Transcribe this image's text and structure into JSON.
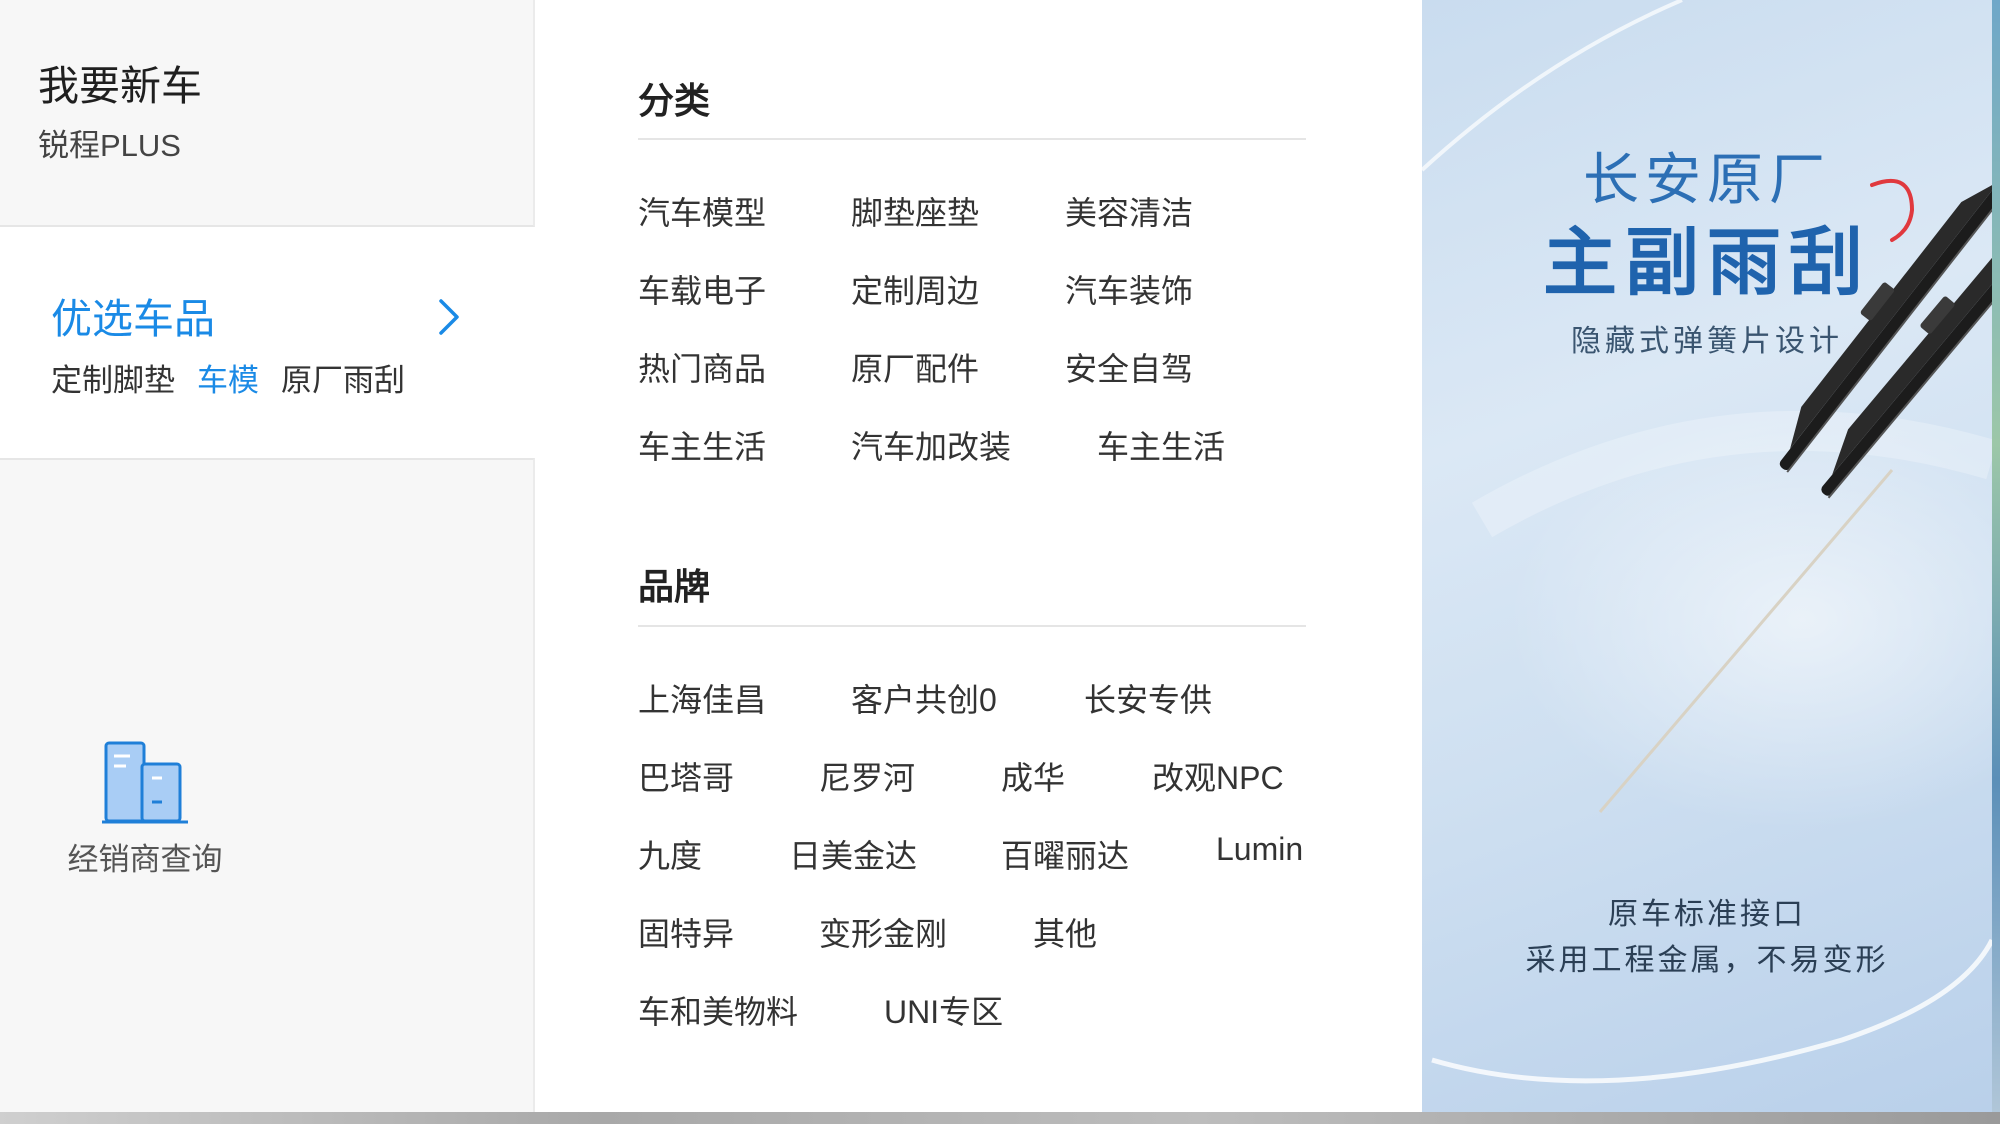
{
  "new_car": {
    "title": "我要新车",
    "model": "锐程PLUS"
  },
  "featured": {
    "title": "优选车品",
    "links": [
      {
        "label": "定制脚垫",
        "active": false
      },
      {
        "label": "车模",
        "active": true
      },
      {
        "label": "原厂雨刮",
        "active": false
      }
    ]
  },
  "dealer": {
    "label": "经销商查询",
    "icon": "dealer-building-icon"
  },
  "category": {
    "title": "分类",
    "rows": [
      [
        "汽车模型",
        "脚垫座垫",
        "美容清洁"
      ],
      [
        "车载电子",
        "定制周边",
        "汽车装饰"
      ],
      [
        "热门商品",
        "原厂配件",
        "安全自驾"
      ],
      [
        "车主生活",
        "汽车加改装",
        "车主生活"
      ]
    ]
  },
  "brand": {
    "title": "品牌",
    "rows": [
      [
        "上海佳昌",
        "客户共创0",
        "长安专供"
      ],
      [
        "巴塔哥",
        "尼罗河",
        "成华",
        "改观NPC"
      ],
      [
        "九度",
        "日美金达",
        "百曜丽达",
        "Lumin"
      ],
      [
        "固特异",
        "变形金刚",
        "其他"
      ],
      [
        "车和美物料",
        "UNI专区"
      ]
    ]
  },
  "banner": {
    "brand": "长安原厂",
    "product": "主副雨刮",
    "tagline": "隐藏式弹簧片设计",
    "line1": "原车标准接口",
    "line2": "采用工程金属，不易变形"
  },
  "colors": {
    "accent": "#1a8ae6",
    "panel_bg": "#f7f7f7",
    "banner_title": "#1f63ad"
  }
}
